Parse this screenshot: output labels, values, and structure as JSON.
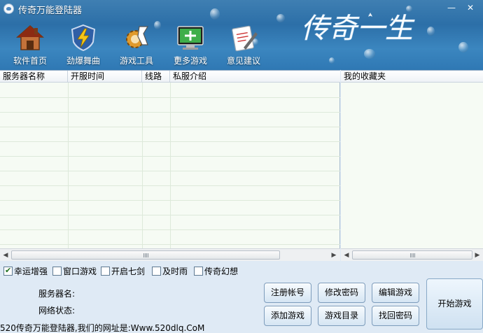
{
  "window": {
    "title": "传奇万能登陆器",
    "brand": "传奇一生",
    "minimize_label": "—",
    "close_label": "✕"
  },
  "toolbar": {
    "items": [
      {
        "label": "软件首页",
        "icon": "home-icon"
      },
      {
        "label": "劲爆舞曲",
        "icon": "lightning-shield-icon"
      },
      {
        "label": "游戏工具",
        "icon": "gear-tool-icon"
      },
      {
        "label": "更多游戏",
        "icon": "monitor-add-icon"
      },
      {
        "label": "意见建议",
        "icon": "feedback-pen-icon"
      }
    ]
  },
  "server_list": {
    "columns": [
      "服务器名称",
      "开服时间",
      "线路",
      "私服介绍"
    ],
    "rows": []
  },
  "favorites": {
    "header": "我的收藏夹",
    "items": []
  },
  "options": [
    {
      "label": "幸运增强",
      "checked": true
    },
    {
      "label": "窗口游戏",
      "checked": false
    },
    {
      "label": "开启七剑",
      "checked": false
    },
    {
      "label": "及时雨",
      "checked": false
    },
    {
      "label": "传奇幻想",
      "checked": false
    }
  ],
  "status": {
    "server_name_label": "服务器名:",
    "server_name_value": "",
    "network_label": "网络状态:",
    "network_value": ""
  },
  "buttons": {
    "register": "注册帐号",
    "change_password": "修改密码",
    "edit_game": "编辑游戏",
    "add_game": "添加游戏",
    "game_directory": "游戏目录",
    "recover_password": "找回密码",
    "start_game": "开始游戏"
  },
  "footer": "520传奇万能登陆器,我们的网址是:Www.520dlq.CoM",
  "colors": {
    "header_blue": "#2c6fa8",
    "panel_bg": "#dfeaf5",
    "list_bg": "#f6fbf4"
  }
}
